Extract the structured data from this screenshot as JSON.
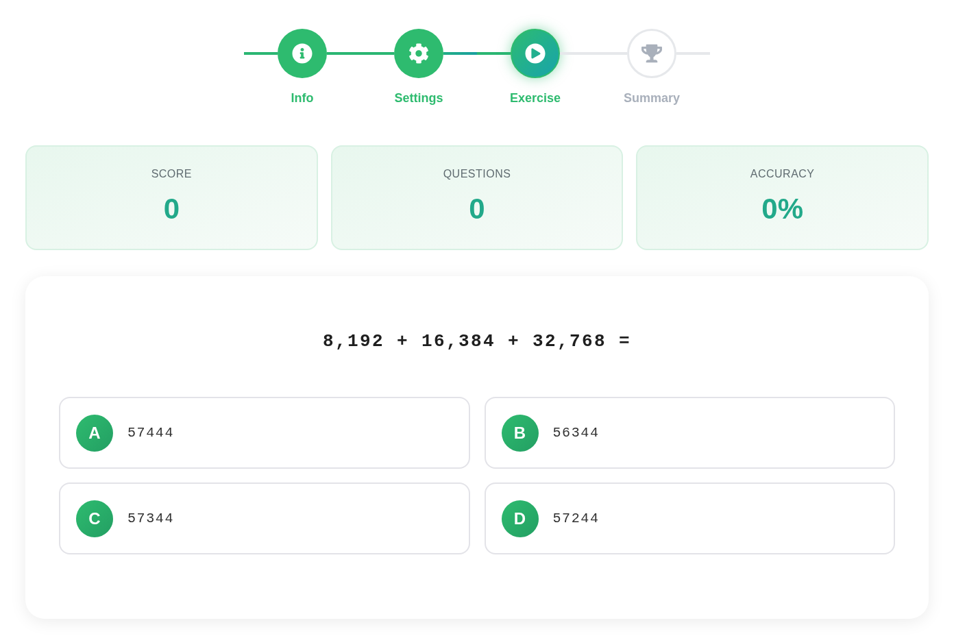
{
  "stepper": {
    "steps": [
      {
        "label": "Info",
        "completed": true,
        "selected": false
      },
      {
        "label": "Settings",
        "completed": true,
        "selected": false
      },
      {
        "label": "Exercise",
        "completed": false,
        "selected": true
      },
      {
        "label": "Summary",
        "completed": false,
        "selected": false
      }
    ]
  },
  "stats": [
    {
      "label": "SCORE",
      "value": "0"
    },
    {
      "label": "QUESTIONS",
      "value": "0"
    },
    {
      "label": "ACCURACY",
      "value": "0%"
    }
  ],
  "exercise": {
    "question": "8,192 + 16,384 + 32,768 =",
    "options": [
      {
        "letter": "A",
        "answer": "57444",
        "selected": false
      },
      {
        "letter": "B",
        "answer": "56344",
        "selected": false
      },
      {
        "letter": "C",
        "answer": "57344",
        "selected": false
      },
      {
        "letter": "D",
        "answer": "57244",
        "selected": false
      }
    ]
  }
}
